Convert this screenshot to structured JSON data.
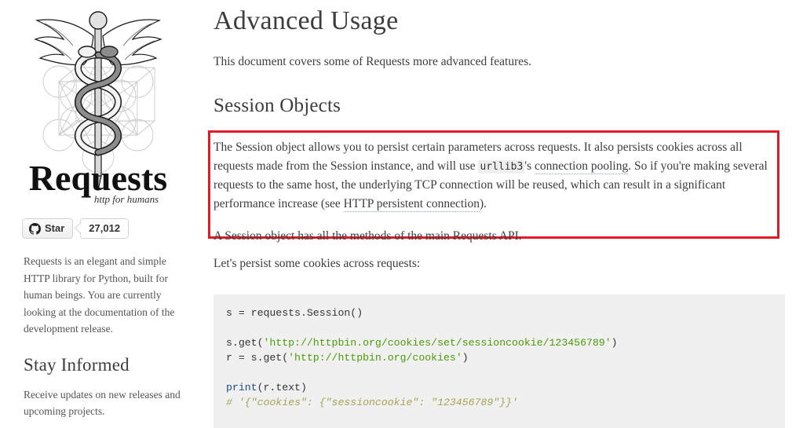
{
  "sidebar": {
    "logo": {
      "wordmark": "Requests",
      "tagline": "http for humans",
      "icon_name": "caduceus-logo"
    },
    "github": {
      "star_label": "Star",
      "star_count": "27,012",
      "icon_name": "github-mark-icon"
    },
    "description": "Requests is an elegant and simple HTTP library for Python, built for human beings. You are currently looking at the documentation of the development release.",
    "stay_informed_heading": "Stay Informed",
    "stay_informed_text": "Receive updates on new releases and upcoming projects."
  },
  "main": {
    "title": "Advanced Usage",
    "intro": "This document covers some of Requests more advanced features.",
    "section_title": "Session Objects",
    "session": {
      "para1_a": "The Session object allows you to persist certain parameters across requests. It also persists cookies across all requests made from the Session instance, and will use ",
      "inline_code": "urllib3",
      "para1_b": "'s ",
      "link1": "connection pooling",
      "para1_c": ". So if you're making several requests to the same host, the underlying TCP connection will be reused, which can result in a significant performance increase (see ",
      "link2": "HTTP persistent connection",
      "para1_d": ").",
      "para2": "A Session object has all the methods of the main Requests API."
    },
    "lead_in": "Let's persist some cookies across requests:",
    "code": {
      "line1_plain": "s = requests.Session()",
      "line2_call": "s.get(",
      "line2_str": "'http://httpbin.org/cookies/set/sessioncookie/123456789'",
      "line2_close": ")",
      "line3_call": "r = s.get(",
      "line3_str": "'http://httpbin.org/cookies'",
      "line3_close": ")",
      "line4_kw": "print",
      "line4_plain": "(r.text)",
      "line5_comment": "# '{\"cookies\": {\"sessioncookie\": \"123456789\"}}'"
    }
  },
  "colors": {
    "highlight_box": "#e01b24",
    "code_background": "#f0f0f0",
    "string_token": "#4e9a06",
    "keyword_token": "#204a87",
    "comment_token": "#a5a553",
    "text": "#3d3d3d"
  }
}
